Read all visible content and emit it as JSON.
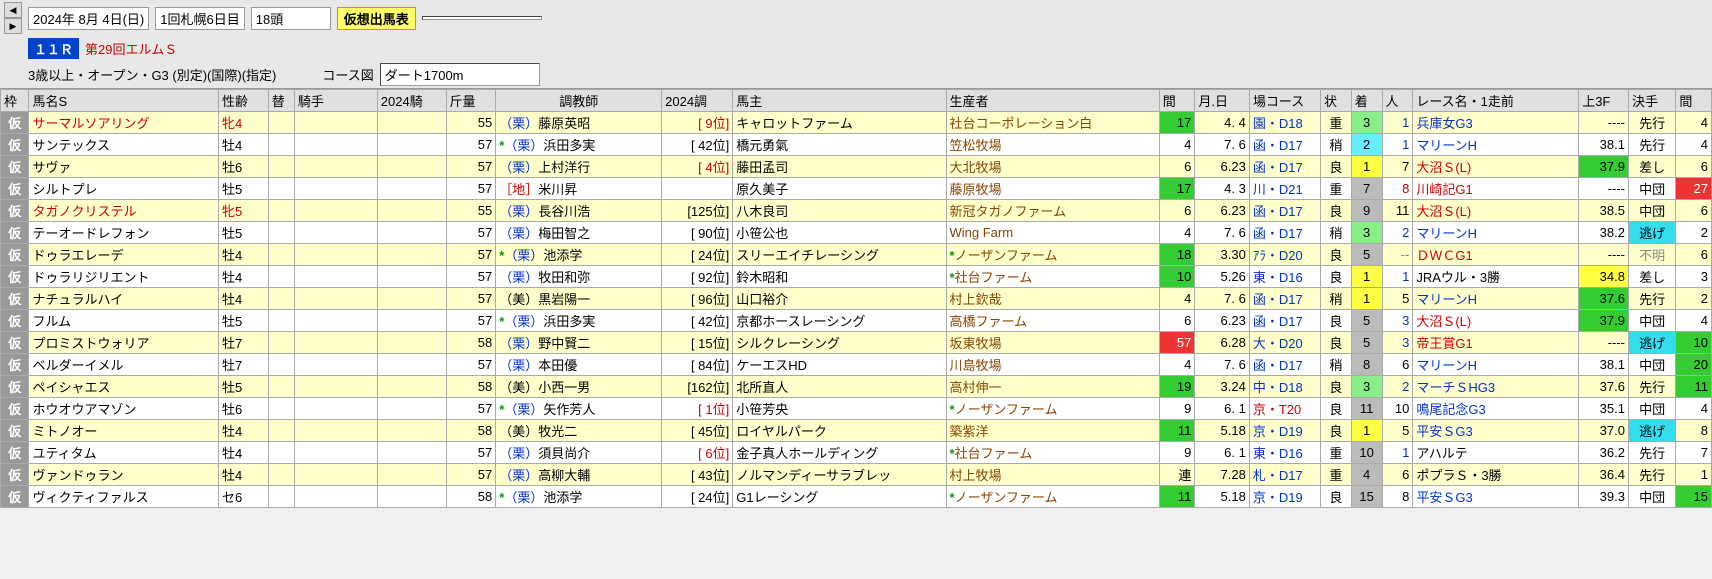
{
  "header": {
    "date": "2024年 8月 4日(日)",
    "meeting": "1回札幌6日目",
    "horses_count": "18頭",
    "virtual_badge": "仮想出馬表",
    "race_no_badge": "１１Ｒ",
    "race_name": "第29回エルムＳ",
    "race_cond": "3歳以上・オープン・G3 (別定)(国際)(指定)",
    "course_label": "コース図",
    "course_value": "ダート1700m"
  },
  "columns": {
    "waku": "枠",
    "name": "馬名S",
    "sexage": "性齢",
    "kae": "替",
    "jockey": "騎手",
    "jrank": "2024騎",
    "weight": "斤量",
    "trainer": "調教師",
    "trank": "2024調",
    "owner": "馬主",
    "breeder": "生産者",
    "kan": "間",
    "date": "月.日",
    "course": "場コース",
    "cond": "状",
    "finish": "着",
    "pop": "人",
    "racename": "レース名・1走前",
    "f3": "上3F",
    "style": "決手",
    "kan2": "間"
  },
  "rows": [
    {
      "waku": "仮",
      "name": "サーマルソアリング",
      "name_cls": "txt-red",
      "sexage": "牝4",
      "sexage_cls": "txt-red",
      "weight": "55",
      "tr_ast": "",
      "tr_prefix": "（栗）",
      "tr_prefix_cls": "txt-blue",
      "tr_name": "藤原英昭",
      "trank": "[   9位]",
      "trank_cls": "txt-red",
      "owner": "キャロットファーム",
      "breeder": "社台コーポレーション白",
      "breeder_cls": "txt-brown",
      "kan": "17",
      "kan_bg": "bg-green",
      "date": "4. 4",
      "course": "園・D18",
      "course_cls": "txt-blue",
      "cond": "重",
      "finish": "3",
      "finish_bg": "bg-ltgreen",
      "pop": "1",
      "pop_cls": "txt-blue",
      "racename": "兵庫女G3",
      "racename_cls": "txt-blue",
      "f3": "----",
      "f3_bg": "",
      "style": "先行",
      "style_bg": "",
      "kan2": "4"
    },
    {
      "waku": "仮",
      "name": "サンテックス",
      "name_cls": "",
      "sexage": "牡4",
      "sexage_cls": "",
      "weight": "57",
      "tr_ast": "*",
      "tr_prefix": "（栗）",
      "tr_prefix_cls": "txt-blue",
      "tr_name": "浜田多実",
      "trank": "[  42位]",
      "trank_cls": "",
      "owner": "橋元勇氣",
      "breeder": "笠松牧場",
      "breeder_cls": "txt-brown",
      "kan": "4",
      "kan_bg": "",
      "date": "7. 6",
      "course": "函・D17",
      "course_cls": "txt-blue",
      "cond": "稍",
      "finish": "2",
      "finish_bg": "bg-cyan2",
      "pop": "1",
      "pop_cls": "txt-blue",
      "racename": "マリーンH",
      "racename_cls": "txt-blue",
      "f3": "38.1",
      "f3_bg": "",
      "style": "先行",
      "style_bg": "",
      "kan2": "4"
    },
    {
      "waku": "仮",
      "name": "サヴァ",
      "name_cls": "",
      "sexage": "牡6",
      "sexage_cls": "",
      "weight": "57",
      "tr_ast": "",
      "tr_prefix": "（栗）",
      "tr_prefix_cls": "txt-blue",
      "tr_name": "上村洋行",
      "trank": "[   4位]",
      "trank_cls": "txt-red",
      "owner": "藤田孟司",
      "breeder": "大北牧場",
      "breeder_cls": "txt-brown",
      "kan": "6",
      "kan_bg": "",
      "date": "6.23",
      "course": "函・D17",
      "course_cls": "txt-blue",
      "cond": "良",
      "finish": "1",
      "finish_bg": "bg-yellow",
      "pop": "7",
      "pop_cls": "",
      "racename": "大沼Ｓ(L)",
      "racename_cls": "txt-red",
      "f3": "37.9",
      "f3_bg": "bg-green",
      "style": "差し",
      "style_bg": "",
      "kan2": "6"
    },
    {
      "waku": "仮",
      "name": "シルトプレ",
      "name_cls": "",
      "sexage": "牡5",
      "sexage_cls": "",
      "weight": "57",
      "tr_ast": "",
      "tr_prefix": "［地］",
      "tr_prefix_cls": "txt-red",
      "tr_name": "米川昇",
      "trank": "",
      "trank_cls": "",
      "owner": "原久美子",
      "breeder": "藤原牧場",
      "breeder_cls": "txt-brown",
      "kan": "17",
      "kan_bg": "bg-green",
      "date": "4. 3",
      "course": "川・D21",
      "course_cls": "txt-blue",
      "cond": "重",
      "finish": "7",
      "finish_bg": "bg-gray",
      "pop": "8",
      "pop_cls": "txt-red",
      "racename": "川崎記G1",
      "racename_cls": "txt-red",
      "f3": "----",
      "f3_bg": "",
      "style": "中団",
      "style_bg": "",
      "kan2": "27",
      "kan2_bg": "bg-red"
    },
    {
      "waku": "仮",
      "name": "タガノクリステル",
      "name_cls": "txt-red",
      "sexage": "牝5",
      "sexage_cls": "txt-red",
      "weight": "55",
      "tr_ast": "",
      "tr_prefix": "（栗）",
      "tr_prefix_cls": "txt-blue",
      "tr_name": "長谷川浩",
      "trank": "[125位]",
      "trank_cls": "",
      "owner": "八木良司",
      "breeder": "新冠タガノファーム",
      "breeder_cls": "txt-brown",
      "kan": "6",
      "kan_bg": "",
      "date": "6.23",
      "course": "函・D17",
      "course_cls": "txt-blue",
      "cond": "良",
      "finish": "9",
      "finish_bg": "bg-gray",
      "pop": "11",
      "pop_cls": "",
      "racename": "大沼Ｓ(L)",
      "racename_cls": "txt-red",
      "f3": "38.5",
      "f3_bg": "",
      "style": "中団",
      "style_bg": "",
      "kan2": "6"
    },
    {
      "waku": "仮",
      "name": "テーオードレフォン",
      "name_cls": "",
      "sexage": "牡5",
      "sexage_cls": "",
      "weight": "57",
      "tr_ast": "",
      "tr_prefix": "（栗）",
      "tr_prefix_cls": "txt-blue",
      "tr_name": "梅田智之",
      "trank": "[  90位]",
      "trank_cls": "",
      "owner": "小笹公也",
      "breeder": "Wing Farm",
      "breeder_cls": "txt-brown",
      "kan": "4",
      "kan_bg": "",
      "date": "7. 6",
      "course": "函・D17",
      "course_cls": "txt-blue",
      "cond": "稍",
      "finish": "3",
      "finish_bg": "bg-ltgreen",
      "pop": "2",
      "pop_cls": "txt-blue",
      "racename": "マリーンH",
      "racename_cls": "txt-blue",
      "f3": "38.2",
      "f3_bg": "",
      "style": "逃げ",
      "style_bg": "bg-cyan",
      "kan2": "2"
    },
    {
      "waku": "仮",
      "name": "ドゥラエレーデ",
      "name_cls": "",
      "sexage": "牡4",
      "sexage_cls": "",
      "weight": "57",
      "tr_ast": "*",
      "tr_prefix": "（栗）",
      "tr_prefix_cls": "txt-blue",
      "tr_name": "池添学",
      "trank": "[  24位]",
      "trank_cls": "",
      "owner": "スリーエイチレーシング",
      "breeder": "ノーザンファーム",
      "breeder_cls": "txt-brown",
      "breeder_ast": "*",
      "kan": "18",
      "kan_bg": "bg-green",
      "date": "3.30",
      "course": "ｱﾗ・D20",
      "course_cls": "txt-blue",
      "cond": "良",
      "finish": "5",
      "finish_bg": "bg-gray",
      "pop": "--",
      "pop_cls": "txt-gray",
      "racename": "ＤＷＣG1",
      "racename_cls": "txt-red",
      "f3": "----",
      "f3_bg": "",
      "style": "不明",
      "style_bg": "",
      "style_cls": "txt-gray",
      "kan2": "6"
    },
    {
      "waku": "仮",
      "name": "ドゥラリジリエント",
      "name_cls": "",
      "sexage": "牡4",
      "sexage_cls": "",
      "weight": "57",
      "tr_ast": "",
      "tr_prefix": "（栗）",
      "tr_prefix_cls": "txt-blue",
      "tr_name": "牧田和弥",
      "trank": "[  92位]",
      "trank_cls": "",
      "owner": "鈴木昭和",
      "breeder": "社台ファーム",
      "breeder_cls": "txt-brown",
      "breeder_ast": "*",
      "kan": "10",
      "kan_bg": "bg-green",
      "date": "5.26",
      "course": "東・D16",
      "course_cls": "txt-blue",
      "cond": "良",
      "finish": "1",
      "finish_bg": "bg-yellow",
      "pop": "1",
      "pop_cls": "txt-blue",
      "racename": "JRAウル・3勝",
      "racename_cls": "",
      "f3": "34.8",
      "f3_bg": "bg-yellow",
      "style": "差し",
      "style_bg": "",
      "kan2": "3"
    },
    {
      "waku": "仮",
      "name": "ナチュラルハイ",
      "name_cls": "",
      "sexage": "牡4",
      "sexage_cls": "",
      "weight": "57",
      "tr_ast": "",
      "tr_prefix": "（美）",
      "tr_prefix_cls": "",
      "tr_name": "黒岩陽一",
      "trank": "[  96位]",
      "trank_cls": "",
      "owner": "山口裕介",
      "breeder": "村上欽哉",
      "breeder_cls": "txt-brown",
      "kan": "4",
      "kan_bg": "",
      "date": "7. 6",
      "course": "函・D17",
      "course_cls": "txt-blue",
      "cond": "稍",
      "finish": "1",
      "finish_bg": "bg-yellow",
      "pop": "5",
      "pop_cls": "",
      "racename": "マリーンH",
      "racename_cls": "txt-blue",
      "f3": "37.6",
      "f3_bg": "bg-green",
      "style": "先行",
      "style_bg": "",
      "kan2": "2"
    },
    {
      "waku": "仮",
      "name": "フルム",
      "name_cls": "",
      "sexage": "牡5",
      "sexage_cls": "",
      "weight": "57",
      "tr_ast": "*",
      "tr_prefix": "（栗）",
      "tr_prefix_cls": "txt-blue",
      "tr_name": "浜田多実",
      "trank": "[  42位]",
      "trank_cls": "",
      "owner": "京都ホースレーシング",
      "breeder": "高橋ファーム",
      "breeder_cls": "txt-brown",
      "kan": "6",
      "kan_bg": "",
      "date": "6.23",
      "course": "函・D17",
      "course_cls": "txt-blue",
      "cond": "良",
      "finish": "5",
      "finish_bg": "bg-gray",
      "pop": "3",
      "pop_cls": "txt-blue",
      "racename": "大沼Ｓ(L)",
      "racename_cls": "txt-red",
      "f3": "37.9",
      "f3_bg": "bg-green",
      "style": "中団",
      "style_bg": "",
      "kan2": "4"
    },
    {
      "waku": "仮",
      "name": "プロミストウォリア",
      "name_cls": "",
      "sexage": "牡7",
      "sexage_cls": "",
      "weight": "58",
      "tr_ast": "",
      "tr_prefix": "（栗）",
      "tr_prefix_cls": "txt-blue",
      "tr_name": "野中賢二",
      "trank": "[  15位]",
      "trank_cls": "",
      "owner": "シルクレーシング",
      "breeder": "坂東牧場",
      "breeder_cls": "txt-brown",
      "kan": "57",
      "kan_bg": "bg-red",
      "date": "6.28",
      "course": "大・D20",
      "course_cls": "txt-blue",
      "cond": "良",
      "finish": "5",
      "finish_bg": "bg-gray",
      "pop": "3",
      "pop_cls": "txt-blue",
      "racename": "帝王賞G1",
      "racename_cls": "txt-red",
      "f3": "----",
      "f3_bg": "",
      "style": "逃げ",
      "style_bg": "bg-cyan",
      "kan2": "10",
      "kan2_bg": "bg-green"
    },
    {
      "waku": "仮",
      "name": "ベルダーイメル",
      "name_cls": "",
      "sexage": "牡7",
      "sexage_cls": "",
      "weight": "57",
      "tr_ast": "",
      "tr_prefix": "（栗）",
      "tr_prefix_cls": "txt-blue",
      "tr_name": "本田優",
      "trank": "[  84位]",
      "trank_cls": "",
      "owner": "ケーエスHD",
      "breeder": "川島牧場",
      "breeder_cls": "txt-brown",
      "kan": "4",
      "kan_bg": "",
      "date": "7. 6",
      "course": "函・D17",
      "course_cls": "txt-blue",
      "cond": "稍",
      "finish": "8",
      "finish_bg": "bg-gray",
      "pop": "6",
      "pop_cls": "",
      "racename": "マリーンH",
      "racename_cls": "txt-blue",
      "f3": "38.1",
      "f3_bg": "",
      "style": "中団",
      "style_bg": "",
      "kan2": "20",
      "kan2_bg": "bg-green"
    },
    {
      "waku": "仮",
      "name": "ペイシャエス",
      "name_cls": "",
      "sexage": "牡5",
      "sexage_cls": "",
      "weight": "58",
      "tr_ast": "",
      "tr_prefix": "（美）",
      "tr_prefix_cls": "",
      "tr_name": "小西一男",
      "trank": "[162位]",
      "trank_cls": "",
      "owner": "北所直人",
      "breeder": "高村伸一",
      "breeder_cls": "txt-brown",
      "kan": "19",
      "kan_bg": "bg-green",
      "date": "3.24",
      "course": "中・D18",
      "course_cls": "txt-blue",
      "cond": "良",
      "finish": "3",
      "finish_bg": "bg-ltgreen",
      "pop": "2",
      "pop_cls": "txt-blue",
      "racename": "マーチＳHG3",
      "racename_cls": "txt-blue",
      "f3": "37.6",
      "f3_bg": "",
      "style": "先行",
      "style_bg": "",
      "kan2": "11",
      "kan2_bg": "bg-green"
    },
    {
      "waku": "仮",
      "name": "ホウオウアマゾン",
      "name_cls": "",
      "sexage": "牡6",
      "sexage_cls": "",
      "weight": "57",
      "tr_ast": "*",
      "tr_prefix": "（栗）",
      "tr_prefix_cls": "txt-blue",
      "tr_name": "矢作芳人",
      "trank": "[   1位]",
      "trank_cls": "txt-red",
      "owner": "小笹芳央",
      "breeder": "ノーザンファーム",
      "breeder_cls": "txt-brown",
      "breeder_ast": "*",
      "kan": "9",
      "kan_bg": "",
      "date": "6. 1",
      "course": "京・T20",
      "course_cls": "txt-red",
      "cond": "良",
      "finish": "11",
      "finish_bg": "bg-gray",
      "pop": "10",
      "pop_cls": "",
      "racename": "鳴尾記念G3",
      "racename_cls": "txt-blue",
      "f3": "35.1",
      "f3_bg": "",
      "style": "中団",
      "style_bg": "",
      "kan2": "4"
    },
    {
      "waku": "仮",
      "name": "ミトノオー",
      "name_cls": "",
      "sexage": "牡4",
      "sexage_cls": "",
      "weight": "58",
      "tr_ast": "",
      "tr_prefix": "（美）",
      "tr_prefix_cls": "",
      "tr_name": "牧光二",
      "trank": "[  45位]",
      "trank_cls": "",
      "owner": "ロイヤルパーク",
      "breeder": "築紫洋",
      "breeder_cls": "txt-brown",
      "kan": "11",
      "kan_bg": "bg-green",
      "date": "5.18",
      "course": "京・D19",
      "course_cls": "txt-blue",
      "cond": "良",
      "finish": "1",
      "finish_bg": "bg-yellow",
      "pop": "5",
      "pop_cls": "",
      "racename": "平安ＳG3",
      "racename_cls": "txt-blue",
      "f3": "37.0",
      "f3_bg": "",
      "style": "逃げ",
      "style_bg": "bg-cyan",
      "kan2": "8"
    },
    {
      "waku": "仮",
      "name": "ユティタム",
      "name_cls": "",
      "sexage": "牡4",
      "sexage_cls": "",
      "weight": "57",
      "tr_ast": "",
      "tr_prefix": "（栗）",
      "tr_prefix_cls": "txt-blue",
      "tr_name": "須貝尚介",
      "trank": "[   6位]",
      "trank_cls": "txt-red",
      "owner": "金子真人ホールディング",
      "breeder": "社台ファーム",
      "breeder_cls": "txt-brown",
      "breeder_ast": "*",
      "kan": "9",
      "kan_bg": "",
      "date": "6. 1",
      "course": "東・D16",
      "course_cls": "txt-blue",
      "cond": "重",
      "finish": "10",
      "finish_bg": "bg-gray",
      "pop": "1",
      "pop_cls": "txt-blue",
      "racename": "アハルテ",
      "racename_cls": "",
      "f3": "36.2",
      "f3_bg": "",
      "style": "先行",
      "style_bg": "",
      "kan2": "7"
    },
    {
      "waku": "仮",
      "name": "ヴァンドゥラン",
      "name_cls": "",
      "sexage": "牡4",
      "sexage_cls": "",
      "weight": "57",
      "tr_ast": "",
      "tr_prefix": "（栗）",
      "tr_prefix_cls": "txt-blue",
      "tr_name": "高柳大輔",
      "trank": "[  43位]",
      "trank_cls": "",
      "owner": "ノルマンディーサラブレッ",
      "breeder": "村上牧場",
      "breeder_cls": "txt-brown",
      "kan": "連",
      "kan_bg": "bg-ybg-yellow",
      "date": "7.28",
      "course": "札・D17",
      "course_cls": "txt-blue",
      "cond": "重",
      "finish": "4",
      "finish_bg": "bg-gray",
      "pop": "6",
      "pop_cls": "",
      "racename": "ポプラＳ・3勝",
      "racename_cls": "",
      "f3": "36.4",
      "f3_bg": "",
      "style": "先行",
      "style_bg": "",
      "kan2": "1"
    },
    {
      "waku": "仮",
      "name": "ヴィクティファルス",
      "name_cls": "",
      "sexage": "セ6",
      "sexage_cls": "",
      "weight": "58",
      "tr_ast": "*",
      "tr_prefix": "（栗）",
      "tr_prefix_cls": "txt-blue",
      "tr_name": "池添学",
      "trank": "[  24位]",
      "trank_cls": "",
      "owner": "G1レーシング",
      "breeder": "ノーザンファーム",
      "breeder_cls": "txt-brown",
      "breeder_ast": "*",
      "kan": "11",
      "kan_bg": "bg-green",
      "date": "5.18",
      "course": "京・D19",
      "course_cls": "txt-blue",
      "cond": "良",
      "finish": "15",
      "finish_bg": "bg-gray",
      "pop": "8",
      "pop_cls": "",
      "racename": "平安ＳG3",
      "racename_cls": "txt-blue",
      "f3": "39.3",
      "f3_bg": "",
      "style": "中団",
      "style_bg": "",
      "kan2": "15",
      "kan2_bg": "bg-green"
    }
  ]
}
